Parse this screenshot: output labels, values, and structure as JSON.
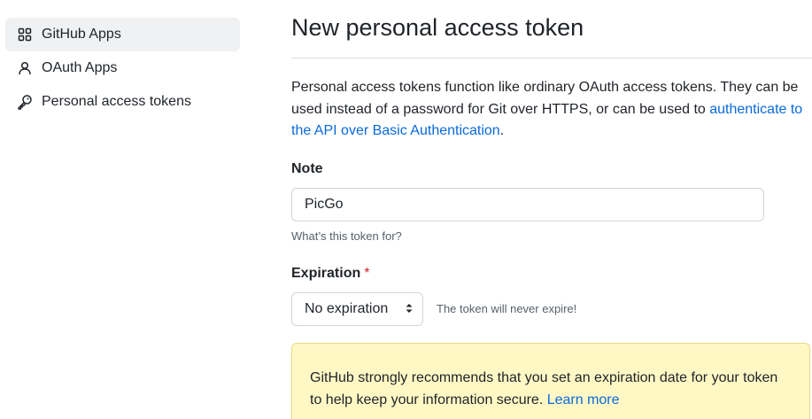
{
  "sidebar": {
    "items": [
      {
        "label": "GitHub Apps",
        "icon": "apps-grid-icon",
        "active": true
      },
      {
        "label": "OAuth Apps",
        "icon": "person-icon",
        "active": false
      },
      {
        "label": "Personal access tokens",
        "icon": "key-icon",
        "active": false
      }
    ]
  },
  "main": {
    "title": "New personal access token",
    "intro": {
      "text": "Personal access tokens function like ordinary OAuth access tokens. They can be used instead of a password for Git over HTTPS, or can be used to ",
      "link": "authenticate to the API over Basic Authentication",
      "suffix": "."
    },
    "note": {
      "label": "Note",
      "value": "PicGo",
      "hint": "What’s this token for?"
    },
    "expiration": {
      "label": "Expiration",
      "required_mark": "*",
      "selected": "No expiration",
      "hint": "The token will never expire!"
    },
    "warning": {
      "text": "GitHub strongly recommends that you set an expiration date for your token to help keep your information secure. ",
      "link": "Learn more"
    }
  },
  "colors": {
    "link": "#0969da",
    "required": "#cf222e",
    "warning_bg": "#fff8c5",
    "active_nav_bg": "#eff1f3"
  }
}
